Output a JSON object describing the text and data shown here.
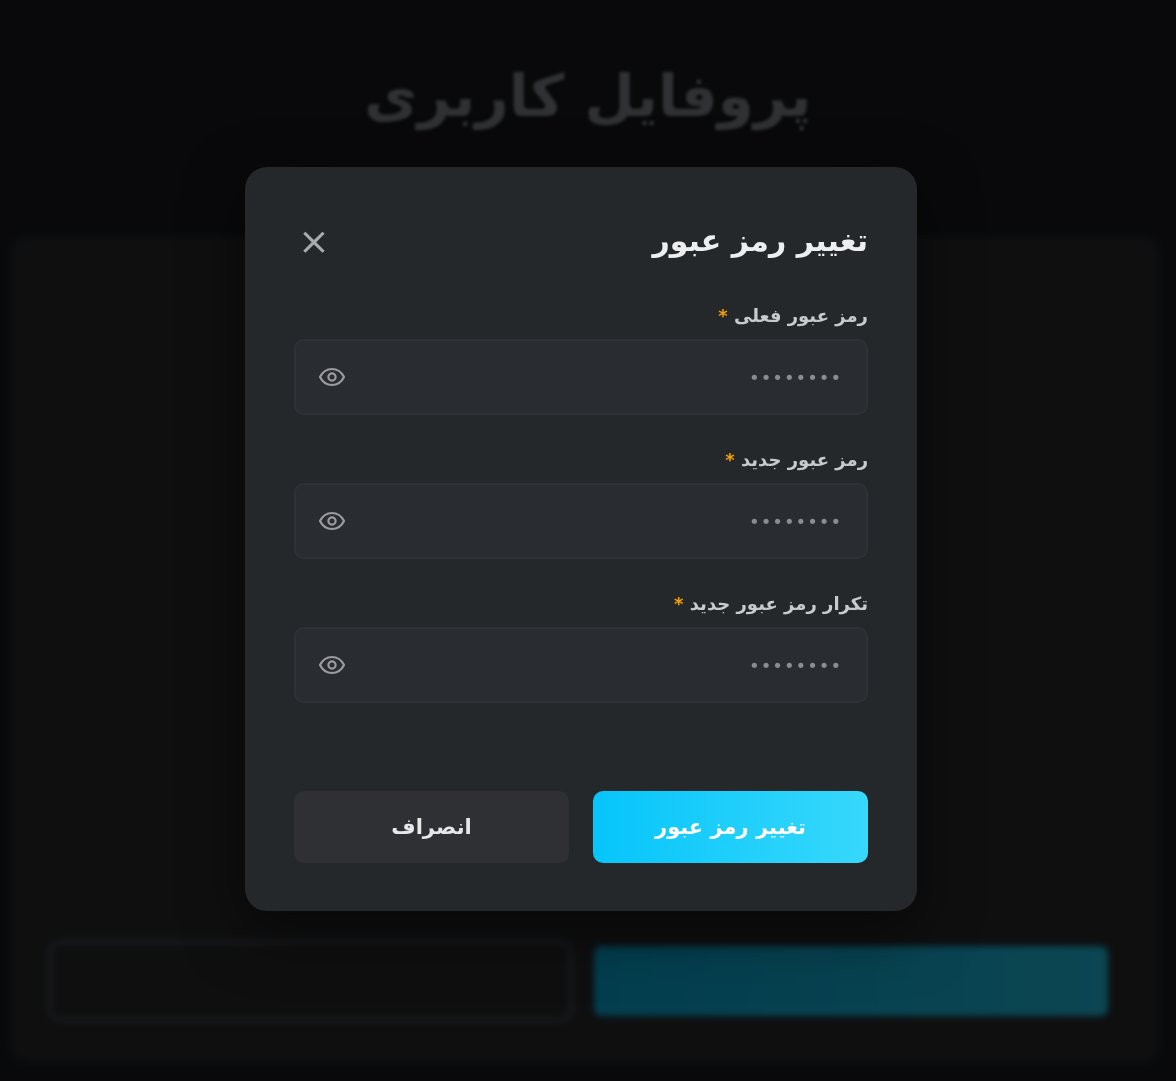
{
  "page": {
    "title": "پروفایل کاربری"
  },
  "dialog": {
    "title": "تغییر رمز عبور",
    "close": "×",
    "fields": [
      {
        "label": "رمز عبور فعلی",
        "required_mark": "*",
        "placeholder": "••••••••"
      },
      {
        "label": "رمز عبور جدید",
        "required_mark": "*",
        "placeholder": "••••••••"
      },
      {
        "label": "تکرار رمز عبور جدید",
        "required_mark": "*",
        "placeholder": "••••••••"
      }
    ],
    "buttons": [
      {
        "label": "تغییر رمز عبور",
        "kind": "primary"
      },
      {
        "label": "انصراف",
        "kind": "secondary"
      }
    ]
  }
}
